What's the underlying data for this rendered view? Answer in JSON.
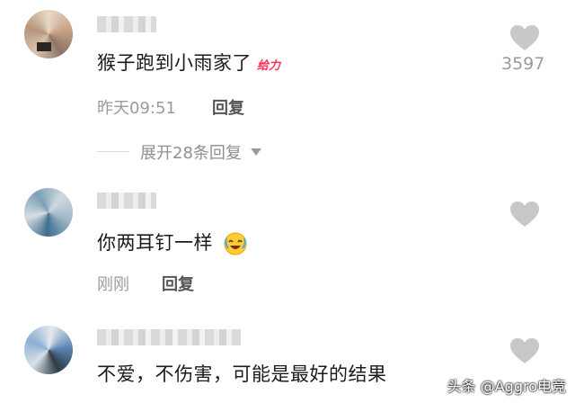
{
  "comments": [
    {
      "text": "猴子跑到小雨家了",
      "badge": "给力",
      "time": "昨天09:51",
      "reply_label": "回复",
      "like_count": "3597",
      "expand_replies": "展开28条回复"
    },
    {
      "text": "你两耳钉一样",
      "emoji": "laughing-emoji",
      "time": "刚刚",
      "reply_label": "回复"
    },
    {
      "text": "不爱，不伤害，可能是最好的结果"
    }
  ],
  "watermark": "头条 @Aggro电竞",
  "colors": {
    "text": "#1b1b1b",
    "meta": "#9b9b9b",
    "heart": "#c8c8c8",
    "badge": "#ff2f5a"
  }
}
